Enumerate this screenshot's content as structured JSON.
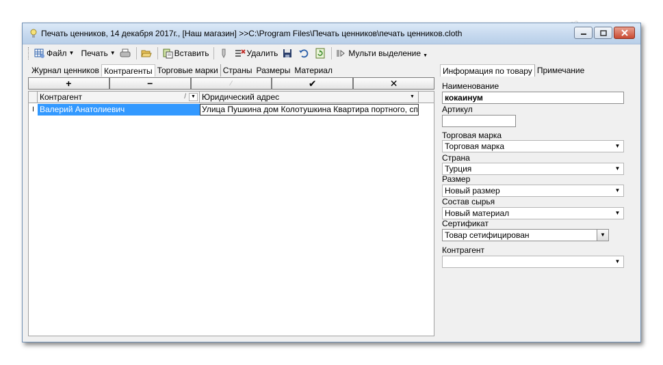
{
  "window": {
    "title": "Печать ценников, 14 декабря 2017г., [Наш магазин] >>C:\\Program Files\\Печать ценников\\печать ценников.cloth"
  },
  "toolbar": {
    "file_label": "Файл",
    "print_label": "Печать",
    "paste_label": "Вставить",
    "delete_label": "Удалить",
    "multi_select_label": "Мульти выделение"
  },
  "left_tabs": [
    "Журнал ценников",
    "Контрагенты",
    "Торговые марки",
    "Страны",
    "Размеры",
    "Материал"
  ],
  "action_buttons": [
    "+",
    "−",
    "⁄",
    "✔",
    "✕"
  ],
  "grid": {
    "columns": [
      "Контрагент",
      "Юридический адрес"
    ],
    "rows": [
      {
        "indicator": "I",
        "name": "Валерий Анатолиевич",
        "address": "Улица Пушкина дом Колотушкина Квартира портного, спроси"
      }
    ]
  },
  "right_tabs": [
    "Информация по товару",
    "Примечание"
  ],
  "form": {
    "name_label": "Наименование",
    "name_value": "кокаинум",
    "article_label": "Артикул",
    "article_value": "",
    "brand_label": "Торговая марка",
    "brand_value": "Торговая марка",
    "country_label": "Страна",
    "country_value": "Турция",
    "size_label": "Размер",
    "size_value": "Новый размер",
    "material_label": "Состав сырья",
    "material_value": "Новый материал",
    "cert_label": "Сертификат",
    "cert_value": "Товар сетифицирован",
    "contractor_label": "Контрагент",
    "contractor_value": ""
  },
  "watermark": "Soringpcrepair.com"
}
